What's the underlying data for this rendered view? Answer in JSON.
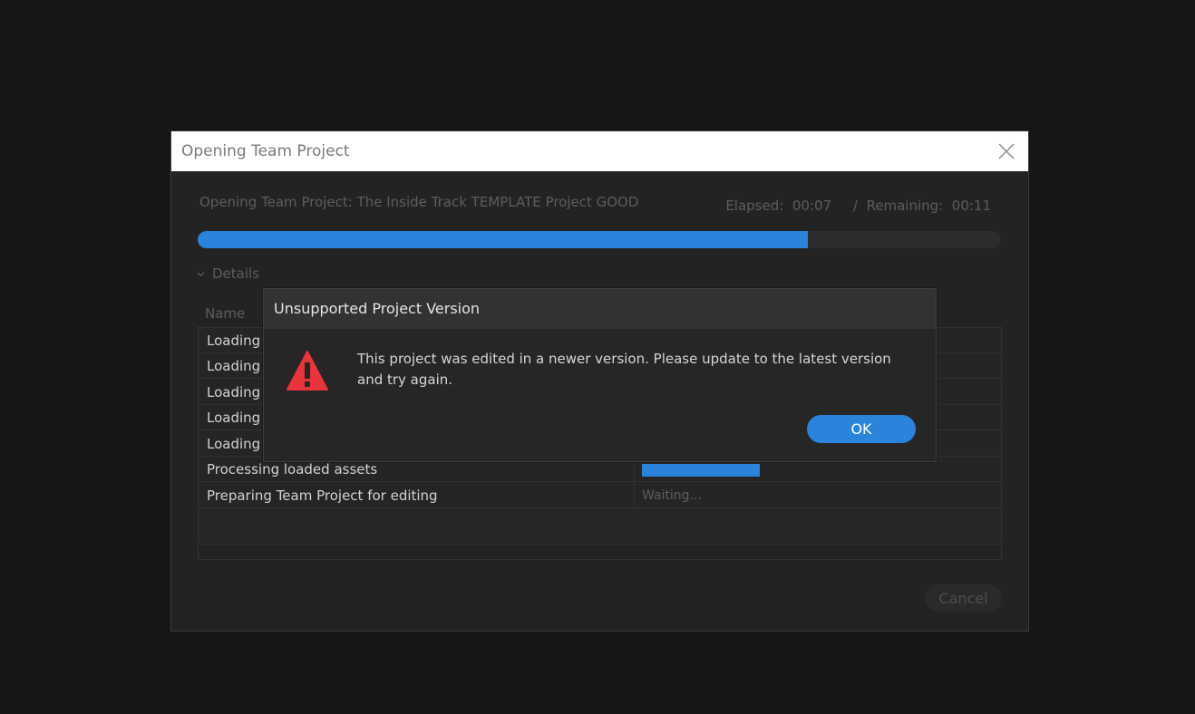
{
  "window": {
    "title": "Opening Team Project",
    "project_line": "Opening Team Project: The Inside Track TEMPLATE Project GOOD",
    "elapsed": "Elapsed:  00:07",
    "separator": "/",
    "remaining": "Remaining:  00:11",
    "progress_fraction": 0.76,
    "details_label": "Details",
    "column_name": "Name",
    "rows": [
      {
        "name": "Loading",
        "status": ""
      },
      {
        "name": "Loading",
        "status": ""
      },
      {
        "name": "Loading",
        "status": ""
      },
      {
        "name": "Loading",
        "status": ""
      },
      {
        "name": "Loading",
        "status": ""
      },
      {
        "name": "Processing loaded assets",
        "status": "",
        "progress_fraction": 0.33
      },
      {
        "name": "Preparing Team Project for editing",
        "status": "Waiting..."
      }
    ],
    "cancel_label": "Cancel"
  },
  "alert": {
    "title": "Unsupported Project Version",
    "message": "This project was edited in a newer version. Please update to the latest version and try again.",
    "ok_label": "OK",
    "icon": "warning-icon"
  },
  "colors": {
    "accent": "#2a84dc",
    "warning": "#e8343a",
    "background": "#161616",
    "panel": "#232323"
  }
}
